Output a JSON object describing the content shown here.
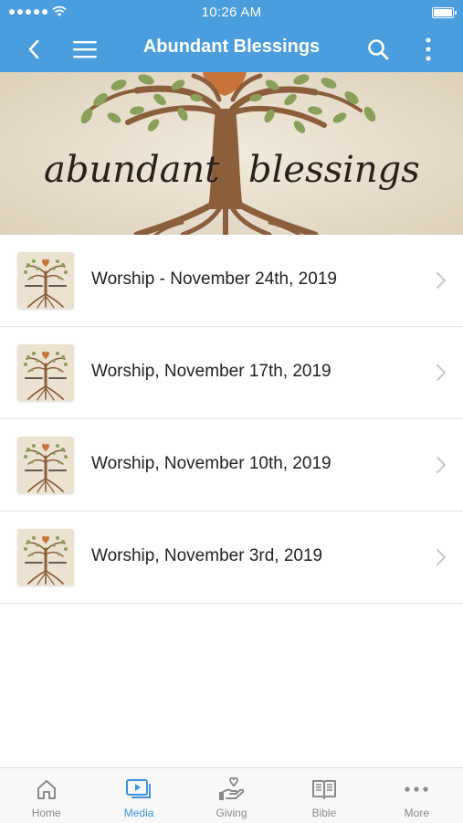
{
  "status": {
    "time": "10:26 AM"
  },
  "nav": {
    "title": "Abundant Blessings"
  },
  "banner": {
    "text_left": "abundant",
    "text_right": "blessings"
  },
  "items": [
    {
      "label": "Worship - November 24th, 2019"
    },
    {
      "label": "Worship, November 17th, 2019"
    },
    {
      "label": "Worship, November 10th, 2019"
    },
    {
      "label": "Worship, November 3rd, 2019"
    }
  ],
  "tabs": [
    {
      "label": "Home",
      "icon": "home-icon",
      "active": false
    },
    {
      "label": "Media",
      "icon": "media-icon",
      "active": true
    },
    {
      "label": "Giving",
      "icon": "giving-icon",
      "active": false
    },
    {
      "label": "Bible",
      "icon": "bible-icon",
      "active": false
    },
    {
      "label": "More",
      "icon": "more-icon",
      "active": false
    }
  ],
  "colors": {
    "header": "#4a9ede",
    "accent": "#3d93dd",
    "tree": "#8b5e3c",
    "leaf": "#8aa05a",
    "heart": "#c8733a"
  }
}
